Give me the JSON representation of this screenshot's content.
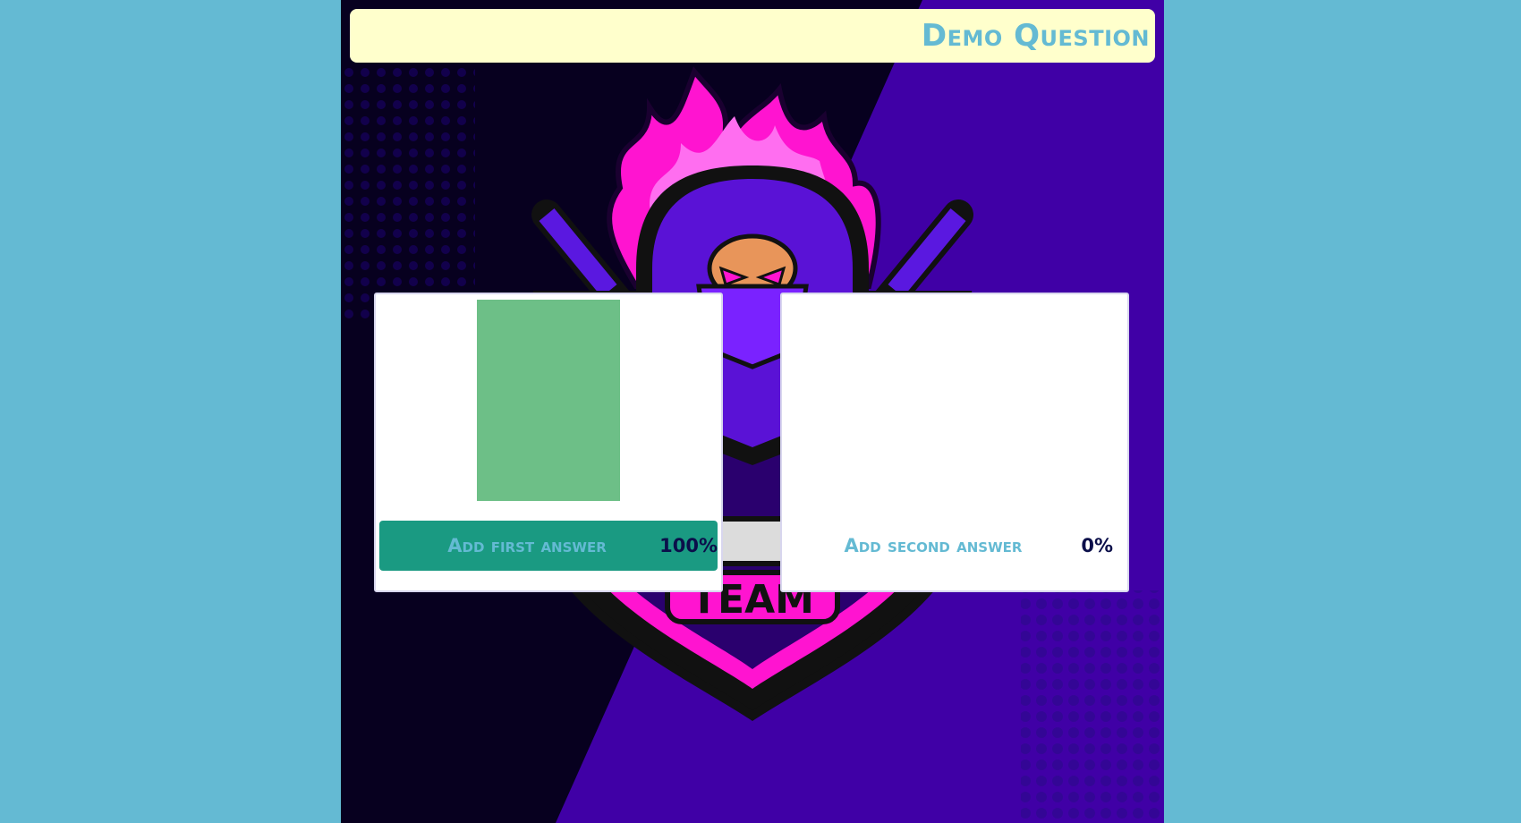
{
  "question": {
    "text": "Demo Question"
  },
  "answers": [
    {
      "label": "Add first answer",
      "percent_text": "100%",
      "percent": 100,
      "selected": true
    },
    {
      "label": "Add second answer",
      "percent_text": "0%",
      "percent": 0,
      "selected": false
    }
  ],
  "logo": {
    "visible_text": "TEAM"
  },
  "colors": {
    "page_background": "#64bad3",
    "banner_background": "#ffffcc",
    "accent_text": "#64bad3",
    "bar_fill": "#6dbf87",
    "selected_answer": "#1a9a82",
    "percent_text": "#0b0f4a",
    "backdrop_dark": "#07001f",
    "backdrop_purple": "#4000a6",
    "logo_pink": "#ff14d0"
  },
  "icons": [
    "ninja-mascot-logo",
    "katana-icon"
  ]
}
